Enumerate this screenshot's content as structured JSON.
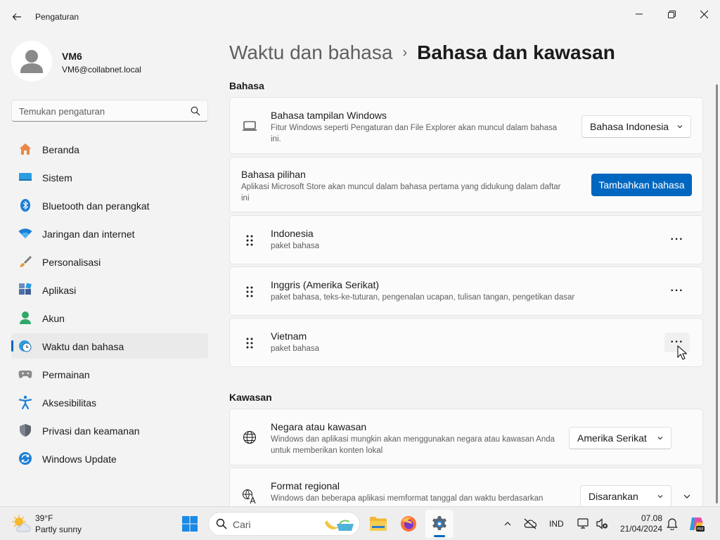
{
  "window": {
    "title": "Pengaturan",
    "controls": {
      "minimize": "minimize-icon",
      "maximize": "restore-icon",
      "close": "close-icon"
    }
  },
  "profile": {
    "name": "VM6",
    "email": "VM6@collabnet.local"
  },
  "search": {
    "placeholder": "Temukan pengaturan"
  },
  "sidebar": {
    "items": [
      {
        "label": "Beranda",
        "icon": "home-icon"
      },
      {
        "label": "Sistem",
        "icon": "monitor-icon"
      },
      {
        "label": "Bluetooth dan perangkat",
        "icon": "bluetooth-icon"
      },
      {
        "label": "Jaringan dan internet",
        "icon": "wifi-icon"
      },
      {
        "label": "Personalisasi",
        "icon": "brush-icon"
      },
      {
        "label": "Aplikasi",
        "icon": "apps-icon"
      },
      {
        "label": "Akun",
        "icon": "account-icon"
      },
      {
        "label": "Waktu dan bahasa",
        "icon": "clock-globe-icon",
        "active": true
      },
      {
        "label": "Permainan",
        "icon": "gamepad-icon"
      },
      {
        "label": "Aksesibilitas",
        "icon": "accessibility-icon"
      },
      {
        "label": "Privasi dan keamanan",
        "icon": "shield-icon"
      },
      {
        "label": "Windows Update",
        "icon": "update-icon"
      }
    ]
  },
  "breadcrumb": {
    "parent": "Waktu dan bahasa",
    "separator": "›",
    "current": "Bahasa dan kawasan"
  },
  "bahasa": {
    "section_title": "Bahasa",
    "display_language": {
      "title": "Bahasa tampilan Windows",
      "desc": "Fitur Windows seperti Pengaturan dan File Explorer akan muncul dalam bahasa ini.",
      "value": "Bahasa Indonesia"
    },
    "preferred": {
      "title": "Bahasa pilihan",
      "desc": "Aplikasi Microsoft Store akan muncul dalam bahasa pertama yang didukung dalam daftar ini",
      "button": "Tambahkan bahasa"
    },
    "languages": [
      {
        "name": "Indonesia",
        "desc": "paket bahasa"
      },
      {
        "name": "Inggris (Amerika Serikat)",
        "desc": "paket bahasa, teks-ke-tuturan, pengenalan ucapan, tulisan tangan, pengetikan dasar"
      },
      {
        "name": "Vietnam",
        "desc": "paket bahasa"
      }
    ],
    "more_label": "···"
  },
  "kawasan": {
    "section_title": "Kawasan",
    "country": {
      "title": "Negara atau kawasan",
      "desc": "Windows dan aplikasi mungkin akan menggunakan negara atau kawasan Anda untuk memberikan konten lokal",
      "value": "Amerika Serikat"
    },
    "regional_format": {
      "title": "Format regional",
      "desc": "Windows dan beberapa aplikasi memformat tanggal dan waktu berdasarkan",
      "value": "Disarankan"
    }
  },
  "taskbar": {
    "weather": {
      "temp": "39°F",
      "desc": "Partly sunny"
    },
    "search_label": "Cari",
    "tray": {
      "language": "IND"
    },
    "clock": {
      "time": "07.08",
      "date": "21/04/2024"
    }
  },
  "colors": {
    "accent": "#0067c0",
    "background": "#f3f3f3",
    "card": "#fbfbfb"
  }
}
